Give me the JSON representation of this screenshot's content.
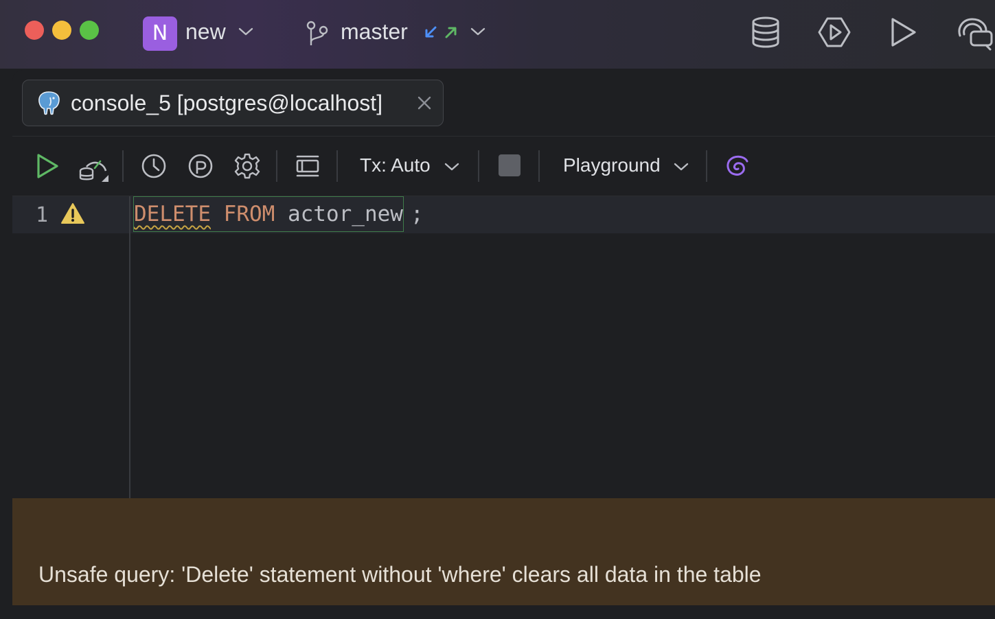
{
  "window": {
    "traffic_lights": [
      "close",
      "minimize",
      "zoom"
    ],
    "project": {
      "badge": "N",
      "name": "new",
      "badge_color": "#9a5fe0"
    },
    "vcs": {
      "branch": "master",
      "incoming_color": "#4d8ff7",
      "outgoing_color": "#5fb865"
    },
    "toolbar_icons": [
      "database-icon",
      "run-config-icon",
      "run-icon",
      "ai-chat-icon"
    ]
  },
  "tab": {
    "label": "console_5 [postgres@localhost]",
    "icon": "postgresql-elephant-icon"
  },
  "editor_toolbar": {
    "tx_mode": "Tx: Auto",
    "schema": "Playground",
    "run_color": "#5fb865",
    "ai_color": "#9b6cf0"
  },
  "editor": {
    "line_number": "1",
    "code": {
      "kw_delete": "DELETE",
      "kw_from": "FROM",
      "table": "actor_new",
      "terminator": ";"
    }
  },
  "banner": {
    "message": "Unsafe query: 'Delete' statement without 'where' clears all data in the table",
    "background": "#433320"
  }
}
